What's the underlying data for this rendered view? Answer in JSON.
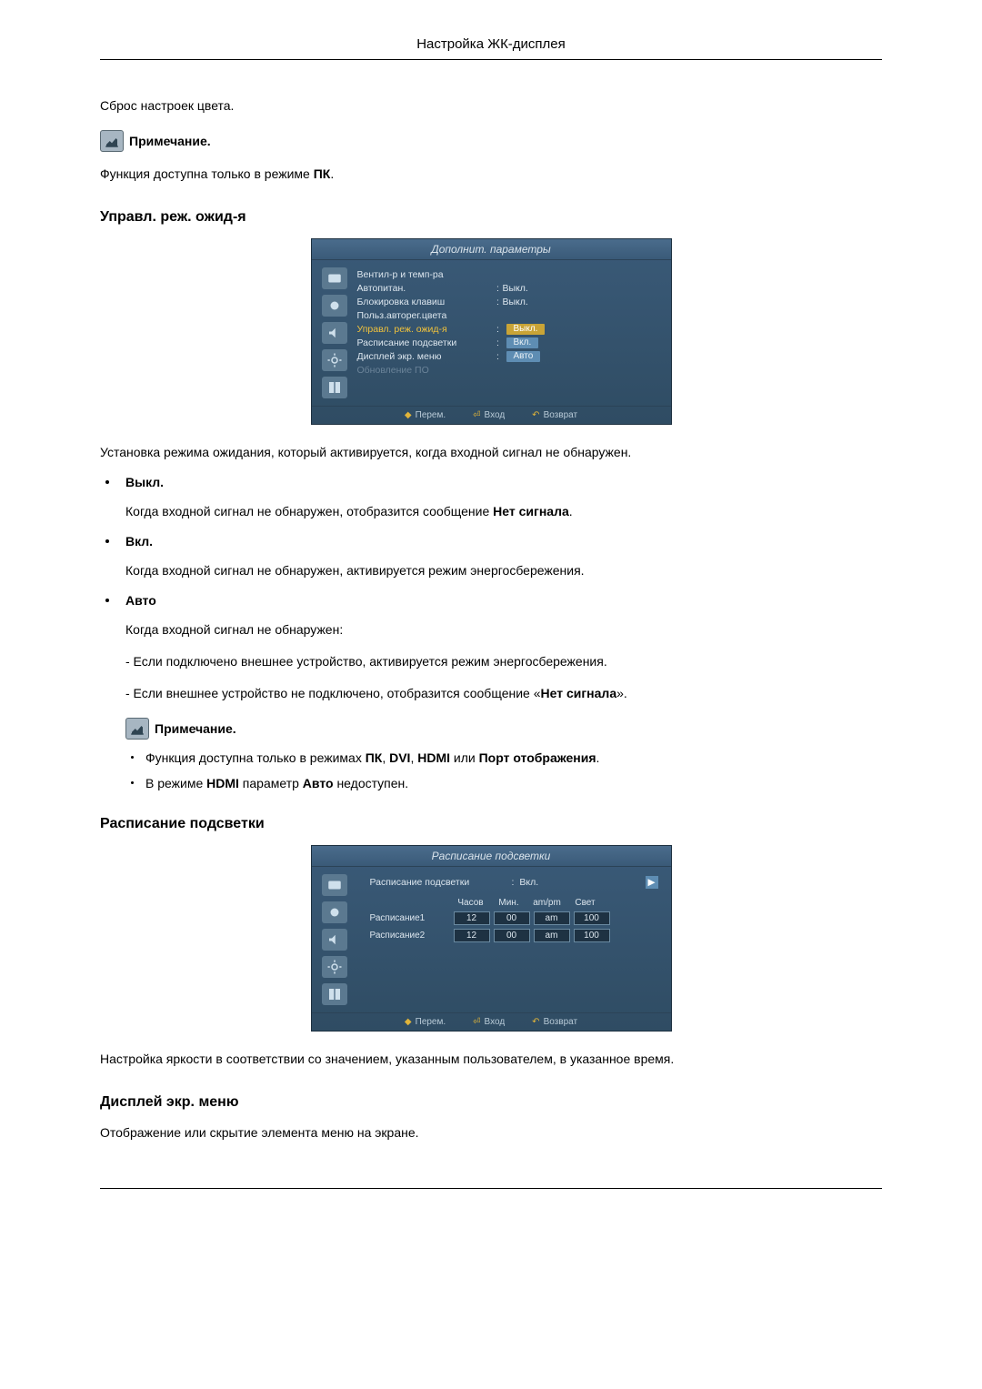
{
  "header": "Настройка ЖК-дисплея",
  "color_reset": "Сброс настроек цвета.",
  "note_label": "Примечание.",
  "note1": "Функция доступна только в режиме ",
  "note1_bold": "ПК",
  "sections": {
    "standby": {
      "heading": "Управл. реж. ожид-я",
      "intro": "Установка режима ожидания, который активируется, когда входной сигнал не обнаружен.",
      "items": [
        {
          "label": "Выкл.",
          "body_pre": "Когда входной сигнал не обнаружен, отобразится сообщение ",
          "body_bold": "Нет сигнала",
          "body_post": "."
        },
        {
          "label": "Вкл.",
          "body": "Когда входной сигнал не обнаружен, активируется режим энергосбережения."
        },
        {
          "label": "Авто",
          "body": "Когда входной сигнал не обнаружен:",
          "sub1": "- Если подключено внешнее устройство, активируется режим энергосбережения.",
          "sub2_pre": "- Если внешнее устройство не подключено, отобразится сообщение «",
          "sub2_bold": "Нет сигнала",
          "sub2_post": "»."
        }
      ],
      "note2_items": [
        {
          "pre": "Функция доступна только в режимах ",
          "b1": "ПК",
          "m1": ", ",
          "b2": "DVI",
          "m2": ", ",
          "b3": "HDMI",
          "m3": " или ",
          "b4": "Порт отображения",
          "post": "."
        },
        {
          "pre": "В режиме ",
          "b1": "HDMI",
          "m1": " параметр ",
          "b2": "Авто",
          "post": " недоступен."
        }
      ]
    },
    "backlight": {
      "heading": "Расписание подсветки",
      "body": "Настройка яркости в соответствии со значением, указанным пользователем, в указанное время."
    },
    "osdmenu": {
      "heading": "Дисплей экр. меню",
      "body": "Отображение или скрытие элемента меню на экране."
    }
  },
  "osd1": {
    "title": "Дополнит. параметры",
    "rows": [
      {
        "label": "Вентил-р и темп-ра",
        "value": "",
        "hl": false
      },
      {
        "label": "Автопитан.",
        "value": "Выкл.",
        "hl": false
      },
      {
        "label": "Блокировка клавиш",
        "value": "Выкл.",
        "hl": false
      },
      {
        "label": "Польз.авторег.цвета",
        "value": "",
        "hl": false
      },
      {
        "label": "Управл. реж. ожид-я",
        "value": "Выкл.",
        "hl": true,
        "box": true
      },
      {
        "label": "Расписание подсветки",
        "value": "Вкл.",
        "hl": false,
        "box": true
      },
      {
        "label": "Дисплей экр. меню",
        "value": "Авто",
        "hl": false,
        "box": true
      },
      {
        "label": "Обновление ПО",
        "value": "",
        "dim": true
      }
    ],
    "footer": {
      "move": "Перем.",
      "enter": "Вход",
      "return": "Возврат"
    }
  },
  "osd2": {
    "title": "Расписание подсветки",
    "top_label": "Расписание подсветки",
    "top_value": "Вкл.",
    "headers": [
      "Часов",
      "Мин.",
      "am/pm",
      "Свет"
    ],
    "rows": [
      {
        "label": "Расписание1",
        "h": "12",
        "m": "00",
        "ap": "am",
        "lv": "100"
      },
      {
        "label": "Расписание2",
        "h": "12",
        "m": "00",
        "ap": "am",
        "lv": "100"
      }
    ],
    "footer": {
      "move": "Перем.",
      "enter": "Вход",
      "return": "Возврат"
    }
  }
}
